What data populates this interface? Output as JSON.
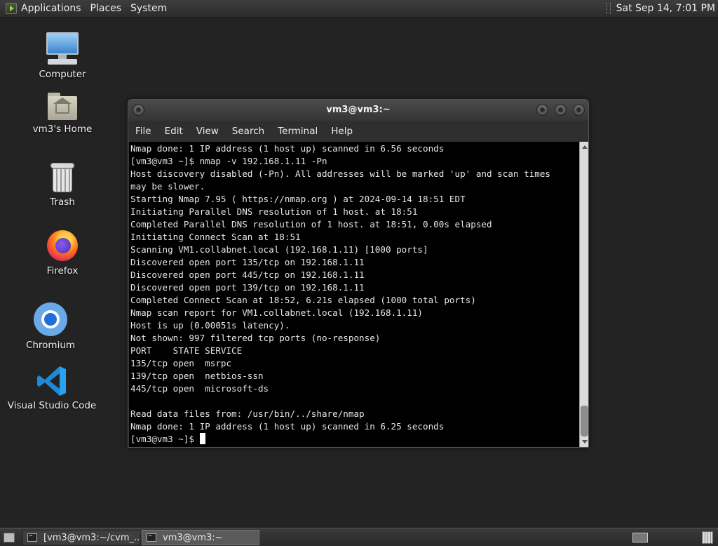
{
  "top_panel": {
    "menus": [
      "Applications",
      "Places",
      "System"
    ],
    "clock": "Sat Sep 14,  7:01 PM"
  },
  "desktop": {
    "icons": [
      {
        "label": "Computer",
        "icon": "computer-icon"
      },
      {
        "label": "vm3's Home",
        "icon": "home-folder-icon"
      },
      {
        "label": "Trash",
        "icon": "trash-icon"
      },
      {
        "label": "Firefox",
        "icon": "firefox-icon"
      },
      {
        "label": "Chromium",
        "icon": "chromium-icon"
      },
      {
        "label": "Visual Studio Code",
        "icon": "vscode-icon"
      }
    ]
  },
  "terminal": {
    "title": "vm3@vm3:~",
    "menu": [
      "File",
      "Edit",
      "View",
      "Search",
      "Terminal",
      "Help"
    ],
    "lines": [
      "Nmap done: 1 IP address (1 host up) scanned in 6.56 seconds",
      "[vm3@vm3 ~]$ nmap -v 192.168.1.11 -Pn",
      "Host discovery disabled (-Pn). All addresses will be marked 'up' and scan times",
      "may be slower.",
      "Starting Nmap 7.95 ( https://nmap.org ) at 2024-09-14 18:51 EDT",
      "Initiating Parallel DNS resolution of 1 host. at 18:51",
      "Completed Parallel DNS resolution of 1 host. at 18:51, 0.00s elapsed",
      "Initiating Connect Scan at 18:51",
      "Scanning VM1.collabnet.local (192.168.1.11) [1000 ports]",
      "Discovered open port 135/tcp on 192.168.1.11",
      "Discovered open port 445/tcp on 192.168.1.11",
      "Discovered open port 139/tcp on 192.168.1.11",
      "Completed Connect Scan at 18:52, 6.21s elapsed (1000 total ports)",
      "Nmap scan report for VM1.collabnet.local (192.168.1.11)",
      "Host is up (0.00051s latency).",
      "Not shown: 997 filtered tcp ports (no-response)",
      "PORT    STATE SERVICE",
      "135/tcp open  msrpc",
      "139/tcp open  netbios-ssn",
      "445/tcp open  microsoft-ds",
      "",
      "Read data files from: /usr/bin/../share/nmap",
      "Nmap done: 1 IP address (1 host up) scanned in 6.25 seconds"
    ],
    "prompt": "[vm3@vm3 ~]$ "
  },
  "taskbar": {
    "tasks": [
      "[vm3@vm3:~/cvm_...",
      "vm3@vm3:~"
    ]
  }
}
